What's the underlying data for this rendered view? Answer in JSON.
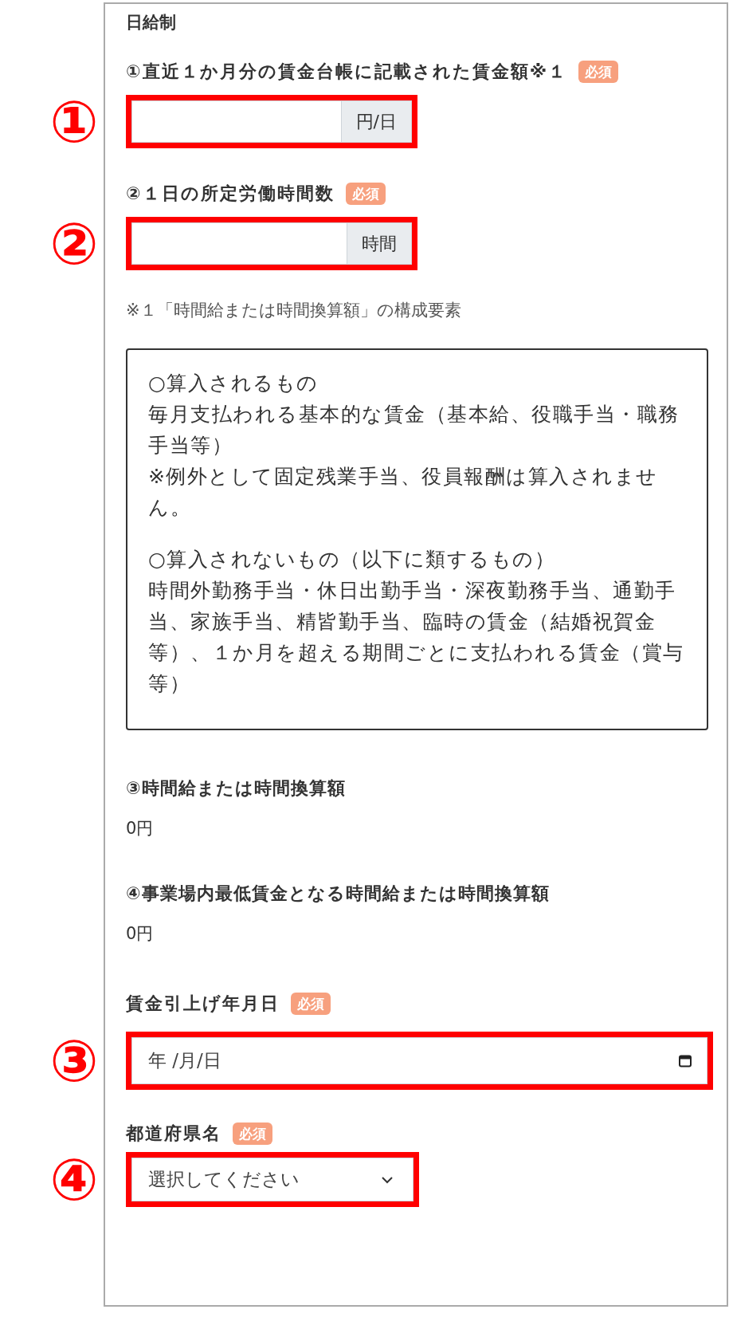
{
  "items": [
    {
      "kind": "heading",
      "text": "日給制"
    },
    {
      "kind": "unit_input",
      "label": "①直近１か月分の賃金台帳に記載された賃金額※１",
      "badge": "必須",
      "unit": "円/日",
      "callout": "①",
      "highlighted": true
    },
    {
      "kind": "unit_input",
      "label": "②１日の所定労働時間数",
      "badge": "必須",
      "unit": "時間",
      "callout": "②",
      "highlighted": true
    },
    {
      "kind": "note",
      "text": "※１「時間給または時間換算額」の構成要素"
    },
    {
      "kind": "info_box",
      "groups": [
        {
          "heading": "○算入されるもの",
          "lines": [
            "毎月支払われる基本的な賃金（基本給、役職手当・職務手当等）",
            "※例外として固定残業手当、役員報酬は算入されません。"
          ]
        },
        {
          "heading": "○算入されないもの（以下に類するもの）",
          "lines": [
            "時間外勤務手当・休日出勤手当・深夜勤務手当、通勤手当、家族手当、精皆勤手当、臨時の賃金（結婚祝賀金等）、１か月を超える期間ごとに支払われる賃金（賞与等）"
          ]
        }
      ]
    },
    {
      "kind": "result",
      "label": "③時間給または時間換算額",
      "value": "0円"
    },
    {
      "kind": "result",
      "label": "④事業場内最低賃金となる時間給または時間換算額",
      "value": "0円"
    },
    {
      "kind": "date_input",
      "label": "賃金引上げ年月日",
      "badge": "必須",
      "placeholder": "年 /月/日",
      "callout": "③",
      "highlighted": true
    },
    {
      "kind": "select",
      "label": "都道府県名",
      "badge": "必須",
      "value": "選択してください",
      "callout": "④",
      "highlighted": true
    }
  ]
}
